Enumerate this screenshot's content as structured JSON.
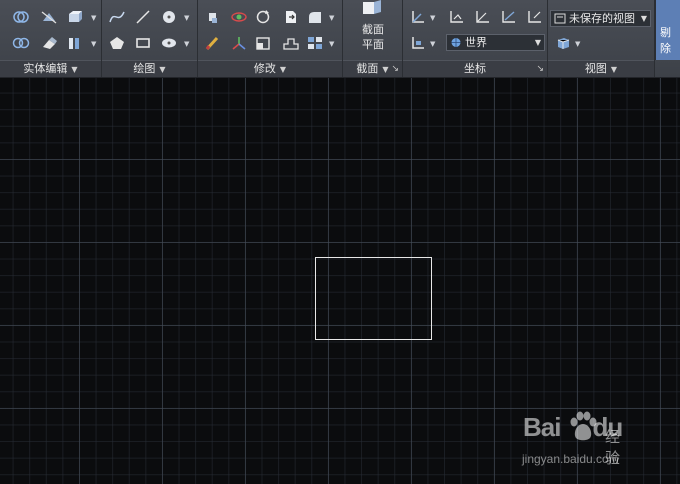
{
  "ribbon": {
    "panels": {
      "solid_edit": {
        "title": "实体编辑",
        "arrow": "▼"
      },
      "draw": {
        "title": "绘图",
        "arrow": "▼"
      },
      "modify": {
        "title": "修改",
        "arrow": "▼"
      },
      "section": {
        "title": "截面",
        "arrow": "▼",
        "launcher": "↘",
        "plane_button_line1": "截面",
        "plane_button_line2": "平面"
      },
      "coordinates": {
        "title": "坐标",
        "launcher": "↘",
        "ucs_combo_value": "世界"
      },
      "view": {
        "title": "视图",
        "arrow": "▼",
        "named_view_value": "未保存的视图"
      }
    },
    "overflow_button_label": "剔除"
  },
  "watermark": {
    "logo": "Bai",
    "logo_tail": "du",
    "cn": "经验",
    "url": "jingyan.baidu.com"
  },
  "colors": {
    "ribbon_bg": "#43474e",
    "canvas_bg": "#0b0c0e",
    "grid_major": "#464e5a",
    "accent_blue": "#5d7fb5",
    "rectangle_stroke": "#e8e8e8"
  }
}
